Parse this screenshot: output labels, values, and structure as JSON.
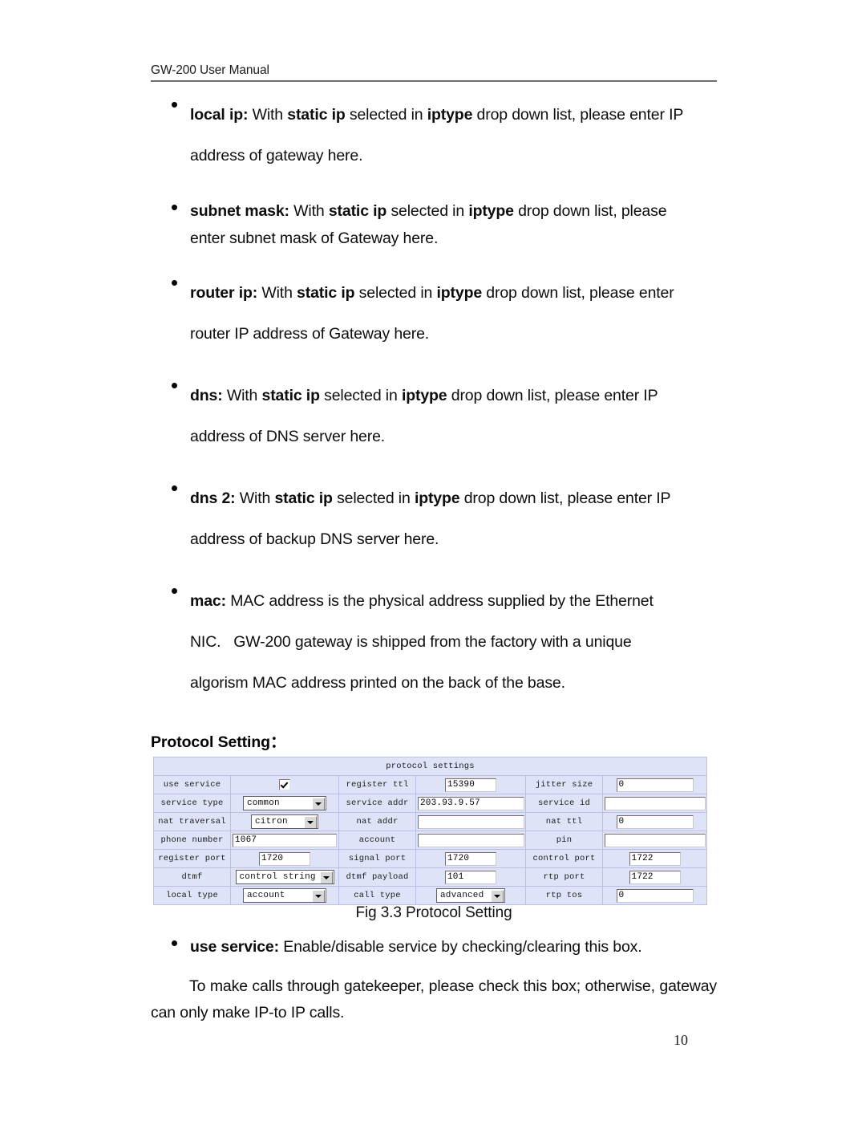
{
  "header": {
    "running_title": "GW-200 User Manual"
  },
  "bullets": [
    {
      "name": "local-ip",
      "term": "local ip:",
      "rest": " With <b>static ip</b> selected in <b>iptype</b> drop down list, please enter IP",
      "line2": "address of gateway here.",
      "spacing": "wide"
    },
    {
      "name": "subnet-mask",
      "term": "subnet mask:",
      "rest": " With <b>static ip</b> selected in <b>iptype</b> drop down list, please",
      "line2": "enter subnet mask of Gateway here.",
      "spacing": "tight"
    },
    {
      "name": "router-ip",
      "term": "router ip:",
      "rest": " With <b>static ip</b> selected in <b>iptype</b> drop down list, please enter",
      "line2": "router IP address of Gateway here.",
      "spacing": "wide"
    },
    {
      "name": "dns",
      "term": "dns:",
      "rest": " With <b>static ip</b> selected in <b>iptype</b> drop down list, please enter IP",
      "line2": "address of DNS server here.",
      "spacing": "wide"
    },
    {
      "name": "dns-2",
      "term": "dns 2:",
      "rest": " With <b>static ip</b> selected in <b>iptype</b> drop down list, please enter IP",
      "line2": "address of backup DNS server here.",
      "spacing": "wide"
    },
    {
      "name": "mac",
      "term": "mac:",
      "rest": " MAC address is the physical address supplied by the Ethernet",
      "line2": "NIC.&nbsp;&nbsp; GW-200 gateway is shipped from the factory with a unique",
      "line3": "algorism MAC address printed on the back of the base.",
      "spacing": "wide"
    }
  ],
  "subheading": "Protocol Setting：",
  "figure": {
    "panel_title": "protocol settings",
    "caption": "Fig 3.3 Protocol Setting",
    "bg_color": "#dfe3f7",
    "border_color": "#b9c0e8",
    "rows": [
      {
        "cells": [
          {
            "label": "use service",
            "type": "checkbox",
            "checked": true
          },
          {
            "label": "register ttl",
            "type": "text",
            "value": "15390",
            "width": "w-sm"
          },
          {
            "label": "jitter size",
            "type": "text",
            "value": "0",
            "width": "w-md"
          }
        ]
      },
      {
        "cells": [
          {
            "label": "service type",
            "type": "select",
            "value": "common",
            "width": "w-a"
          },
          {
            "label": "service addr",
            "type": "text",
            "value": "203.93.9.57",
            "width": "w-xl"
          },
          {
            "label": "service id",
            "type": "text",
            "value": "",
            "width": "w-full"
          }
        ]
      },
      {
        "cells": [
          {
            "label": "nat traversal",
            "type": "select",
            "value": "citron",
            "width": "w-b"
          },
          {
            "label": "nat addr",
            "type": "text",
            "value": "",
            "width": "w-xl"
          },
          {
            "label": "nat ttl",
            "type": "text",
            "value": "0",
            "width": "w-md"
          }
        ]
      },
      {
        "cells": [
          {
            "label": "phone number",
            "type": "text",
            "value": "1067",
            "width": "w-lg"
          },
          {
            "label": "account",
            "type": "text",
            "value": "",
            "width": "w-xl"
          },
          {
            "label": "pin",
            "type": "text",
            "value": "",
            "width": "w-full"
          }
        ]
      },
      {
        "cells": [
          {
            "label": "register port",
            "type": "text",
            "value": "1720",
            "width": "w-sm"
          },
          {
            "label": "signal port",
            "type": "text",
            "value": "1720",
            "width": "w-sm"
          },
          {
            "label": "control port",
            "type": "text",
            "value": "1722",
            "width": "w-sm"
          }
        ]
      },
      {
        "cells": [
          {
            "label": "dtmf",
            "type": "select",
            "value": "control string",
            "width": "w-c"
          },
          {
            "label": "dtmf payload",
            "type": "text",
            "value": "101",
            "width": "w-sm"
          },
          {
            "label": "rtp port",
            "type": "text",
            "value": "1722",
            "width": "w-sm"
          }
        ]
      },
      {
        "cells": [
          {
            "label": "local type",
            "type": "select",
            "value": "account",
            "width": "w-d"
          },
          {
            "label": "call type",
            "type": "select",
            "value": "advanced",
            "width": "w-e"
          },
          {
            "label": "rtp tos",
            "type": "text",
            "value": "0",
            "width": "w-md"
          }
        ]
      }
    ]
  },
  "after_figure": {
    "bullet": {
      "term": "use service:",
      "rest": " Enable/disable service by checking/clearing this box."
    },
    "closing_paragraph": "To make calls through gatekeeper, please check this box; otherwise, gateway can only make IP-to IP calls."
  },
  "page_number": "10"
}
